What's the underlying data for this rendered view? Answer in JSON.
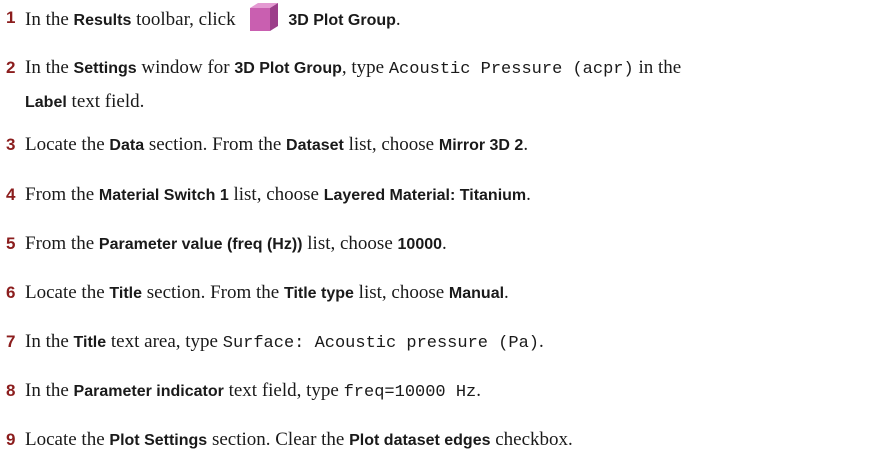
{
  "steps": [
    {
      "num": "1",
      "parts": [
        {
          "t": "In the ",
          "s": "r"
        },
        {
          "t": "Results",
          "s": "b"
        },
        {
          "t": " toolbar, click ",
          "s": "r"
        },
        {
          "icon": "3d-plot-group-icon"
        },
        {
          "t": "3D Plot Group",
          "s": "b"
        },
        {
          "t": ".",
          "s": "r"
        }
      ]
    },
    {
      "num": "2",
      "parts": [
        {
          "t": "In the ",
          "s": "r"
        },
        {
          "t": "Settings",
          "s": "b"
        },
        {
          "t": " window for ",
          "s": "r"
        },
        {
          "t": "3D Plot Group",
          "s": "b"
        },
        {
          "t": ", type ",
          "s": "r"
        },
        {
          "t": "Acoustic Pressure (acpr)",
          "s": "m"
        },
        {
          "t": " in the",
          "s": "r"
        },
        {
          "br": true
        },
        {
          "t": "Label",
          "s": "b"
        },
        {
          "t": " text field.",
          "s": "r"
        }
      ]
    },
    {
      "num": "3",
      "parts": [
        {
          "t": "Locate the ",
          "s": "r"
        },
        {
          "t": "Data",
          "s": "b"
        },
        {
          "t": " section. From the ",
          "s": "r"
        },
        {
          "t": "Dataset",
          "s": "b"
        },
        {
          "t": " list, choose ",
          "s": "r"
        },
        {
          "t": "Mirror 3D 2",
          "s": "b"
        },
        {
          "t": ".",
          "s": "r"
        }
      ]
    },
    {
      "num": "4",
      "parts": [
        {
          "t": "From the ",
          "s": "r"
        },
        {
          "t": "Material Switch 1",
          "s": "b"
        },
        {
          "t": " list, choose ",
          "s": "r"
        },
        {
          "t": "Layered Material: Titanium",
          "s": "b"
        },
        {
          "t": ".",
          "s": "r"
        }
      ]
    },
    {
      "num": "5",
      "parts": [
        {
          "t": "From the ",
          "s": "r"
        },
        {
          "t": "Parameter value (freq (Hz))",
          "s": "b"
        },
        {
          "t": " list, choose ",
          "s": "r"
        },
        {
          "t": "10000",
          "s": "b"
        },
        {
          "t": ".",
          "s": "r"
        }
      ]
    },
    {
      "num": "6",
      "parts": [
        {
          "t": "Locate the ",
          "s": "r"
        },
        {
          "t": "Title",
          "s": "b"
        },
        {
          "t": " section. From the ",
          "s": "r"
        },
        {
          "t": "Title type",
          "s": "b"
        },
        {
          "t": " list, choose ",
          "s": "r"
        },
        {
          "t": "Manual",
          "s": "b"
        },
        {
          "t": ".",
          "s": "r"
        }
      ]
    },
    {
      "num": "7",
      "parts": [
        {
          "t": "In the ",
          "s": "r"
        },
        {
          "t": "Title",
          "s": "b"
        },
        {
          "t": " text area, type ",
          "s": "r"
        },
        {
          "t": "Surface: Acoustic pressure (Pa)",
          "s": "m"
        },
        {
          "t": ".",
          "s": "r"
        }
      ]
    },
    {
      "num": "8",
      "parts": [
        {
          "t": "In the ",
          "s": "r"
        },
        {
          "t": "Parameter indicator",
          "s": "b"
        },
        {
          "t": " text field, type ",
          "s": "r"
        },
        {
          "t": "freq=10000 Hz",
          "s": "m"
        },
        {
          "t": ".",
          "s": "r"
        }
      ]
    },
    {
      "num": "9",
      "parts": [
        {
          "t": "Locate the ",
          "s": "r"
        },
        {
          "t": "Plot Settings",
          "s": "b"
        },
        {
          "t": " section. Clear the ",
          "s": "r"
        },
        {
          "t": "Plot dataset edges",
          "s": "b"
        },
        {
          "t": " checkbox.",
          "s": "r"
        }
      ]
    }
  ],
  "icon_colors": {
    "front": "#c95fb0",
    "top": "#e49ad2",
    "side": "#9c3f8a"
  }
}
